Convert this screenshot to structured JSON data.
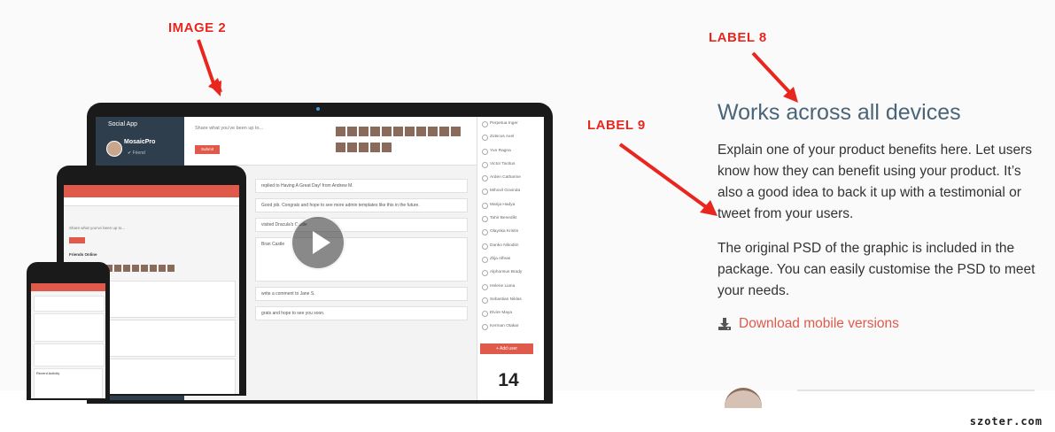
{
  "annotations": {
    "image_2": "IMAGE 2",
    "label_8": "LABEL 8",
    "label_9": "LABEL 9"
  },
  "feature": {
    "title": "Works across all devices",
    "paragraph_1": "Explain one of your product benefits here. Let users know how they can benefit using your product. It’s also a good idea to back it up with a testimonial or tweet from your users.",
    "paragraph_2": "The original PSD of the graphic is included in the package. You can easily customise the PSD to meet your needs.",
    "download_link": "Download mobile versions",
    "download_icon": "download-icon"
  },
  "mockup": {
    "laptop": {
      "app_title": "Social App",
      "user_name": "MosaicPro",
      "user_sub": "✔ Friend",
      "share_placeholder": "Share what you've been up to...",
      "submit_label": "Submit",
      "people": [
        "Perpetua Inger",
        "Zotscus Axel",
        "Yun Ragna",
        "Victor Tacitus",
        "Arden Catharine",
        "Mihovil Govinda",
        "Marija Hadya",
        "Tahir Benedikt",
        "Olaynka Kristin",
        "Danko Nikodim",
        "Zlija Alfeas",
        "Alphonsus Brady",
        "Helene Liana",
        "Sebastian Niklas",
        "Elvire Maya",
        "Kerman Otakar"
      ],
      "add_user": "+ Add user",
      "count": "14",
      "feed_1": "replied to Having A Great Day! from Andrew M.",
      "feed_2": "Good job. Congrats and hope to see more admin templates like this in the future.",
      "feed_3": "visited Dracula's Castle",
      "feed_4": "Bran Castle",
      "feed_5": "write a comment to Jane S.",
      "feed_6": "grats and hope to see you soon."
    },
    "tablet": {
      "share_placeholder": "Share what you've been up to...",
      "friends_online": "Friends Online"
    },
    "phone": {
      "recent_activity": "Recent Activity"
    },
    "play_icon": "play-icon"
  },
  "watermark": "szoter.com",
  "colors": {
    "accent": "#e05a4b",
    "annotation": "#e8261e",
    "title": "#4a6478",
    "body_text": "#333333"
  }
}
